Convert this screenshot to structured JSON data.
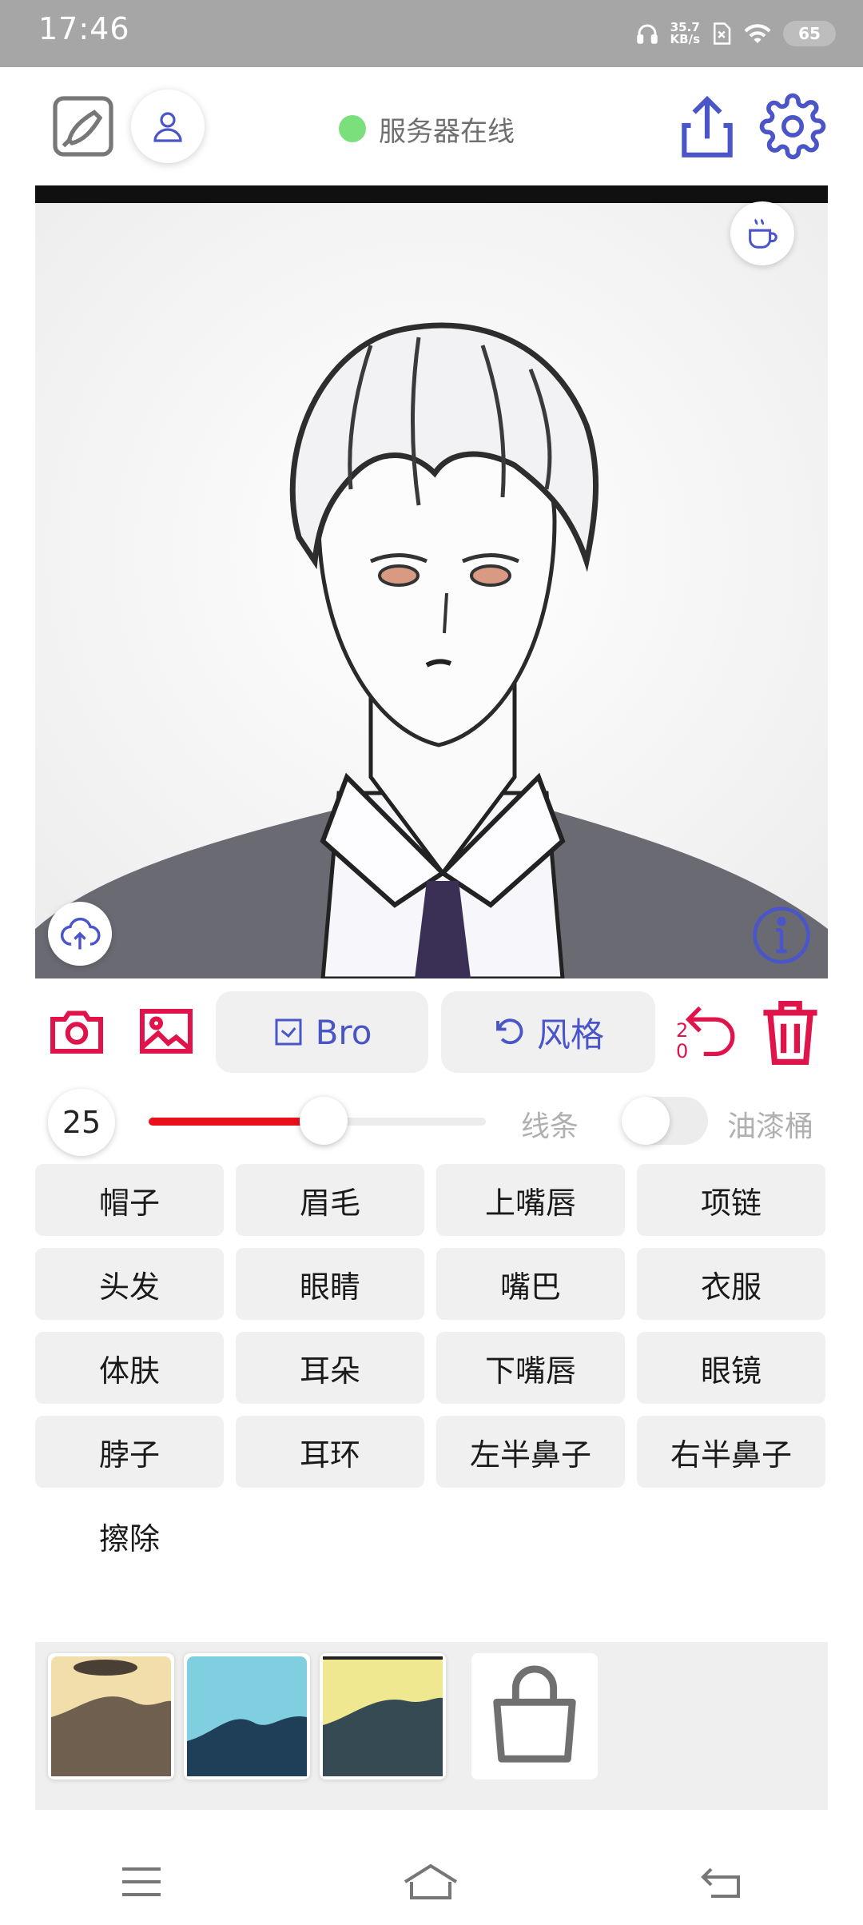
{
  "status_bar": {
    "time": "17:46",
    "speed_value": "35.7",
    "speed_unit": "KB/s",
    "battery": "65",
    "icons": [
      "headphones-icon",
      "sim-off-icon",
      "wifi-icon"
    ]
  },
  "header": {
    "server_status": "服务器在线",
    "server_status_color": "#7be07b",
    "icons": [
      "draw-mode-icon",
      "user-icon",
      "share-icon",
      "settings-icon"
    ]
  },
  "canvas": {
    "description_icons": [
      "coffee-icon",
      "cloud-upload-icon",
      "info-icon"
    ]
  },
  "toolbar": {
    "brush_label": "Bro",
    "style_label": "风格",
    "undo_count_top": "2",
    "undo_count_bottom": "0",
    "accent_color": "#e0144b",
    "primary_color": "#4a56c8"
  },
  "brush": {
    "size": "25",
    "slider_fraction": 0.52,
    "line_label": "线条",
    "fill_label": "油漆桶",
    "fill_enabled": false
  },
  "parts": [
    {
      "label": "帽子"
    },
    {
      "label": "眉毛"
    },
    {
      "label": "上嘴唇"
    },
    {
      "label": "项链"
    },
    {
      "label": "头发"
    },
    {
      "label": "眼睛"
    },
    {
      "label": "嘴巴"
    },
    {
      "label": "衣服"
    },
    {
      "label": "体肤"
    },
    {
      "label": "耳朵"
    },
    {
      "label": "下嘴唇"
    },
    {
      "label": "眼镜"
    },
    {
      "label": "脖子"
    },
    {
      "label": "耳环"
    },
    {
      "label": "左半鼻子"
    },
    {
      "label": "右半鼻子"
    },
    {
      "label": "擦除"
    }
  ],
  "palette": {
    "swatches": [
      {
        "sky": "#f2deaa",
        "ground": "#6e5f4f"
      },
      {
        "sky": "#7fcfe0",
        "ground": "#1f3f58"
      },
      {
        "sky": "#efe890",
        "ground": "#354a52"
      }
    ],
    "shop_icon": "bag-icon"
  },
  "nav": [
    "menu-icon",
    "home-icon",
    "back-icon"
  ]
}
